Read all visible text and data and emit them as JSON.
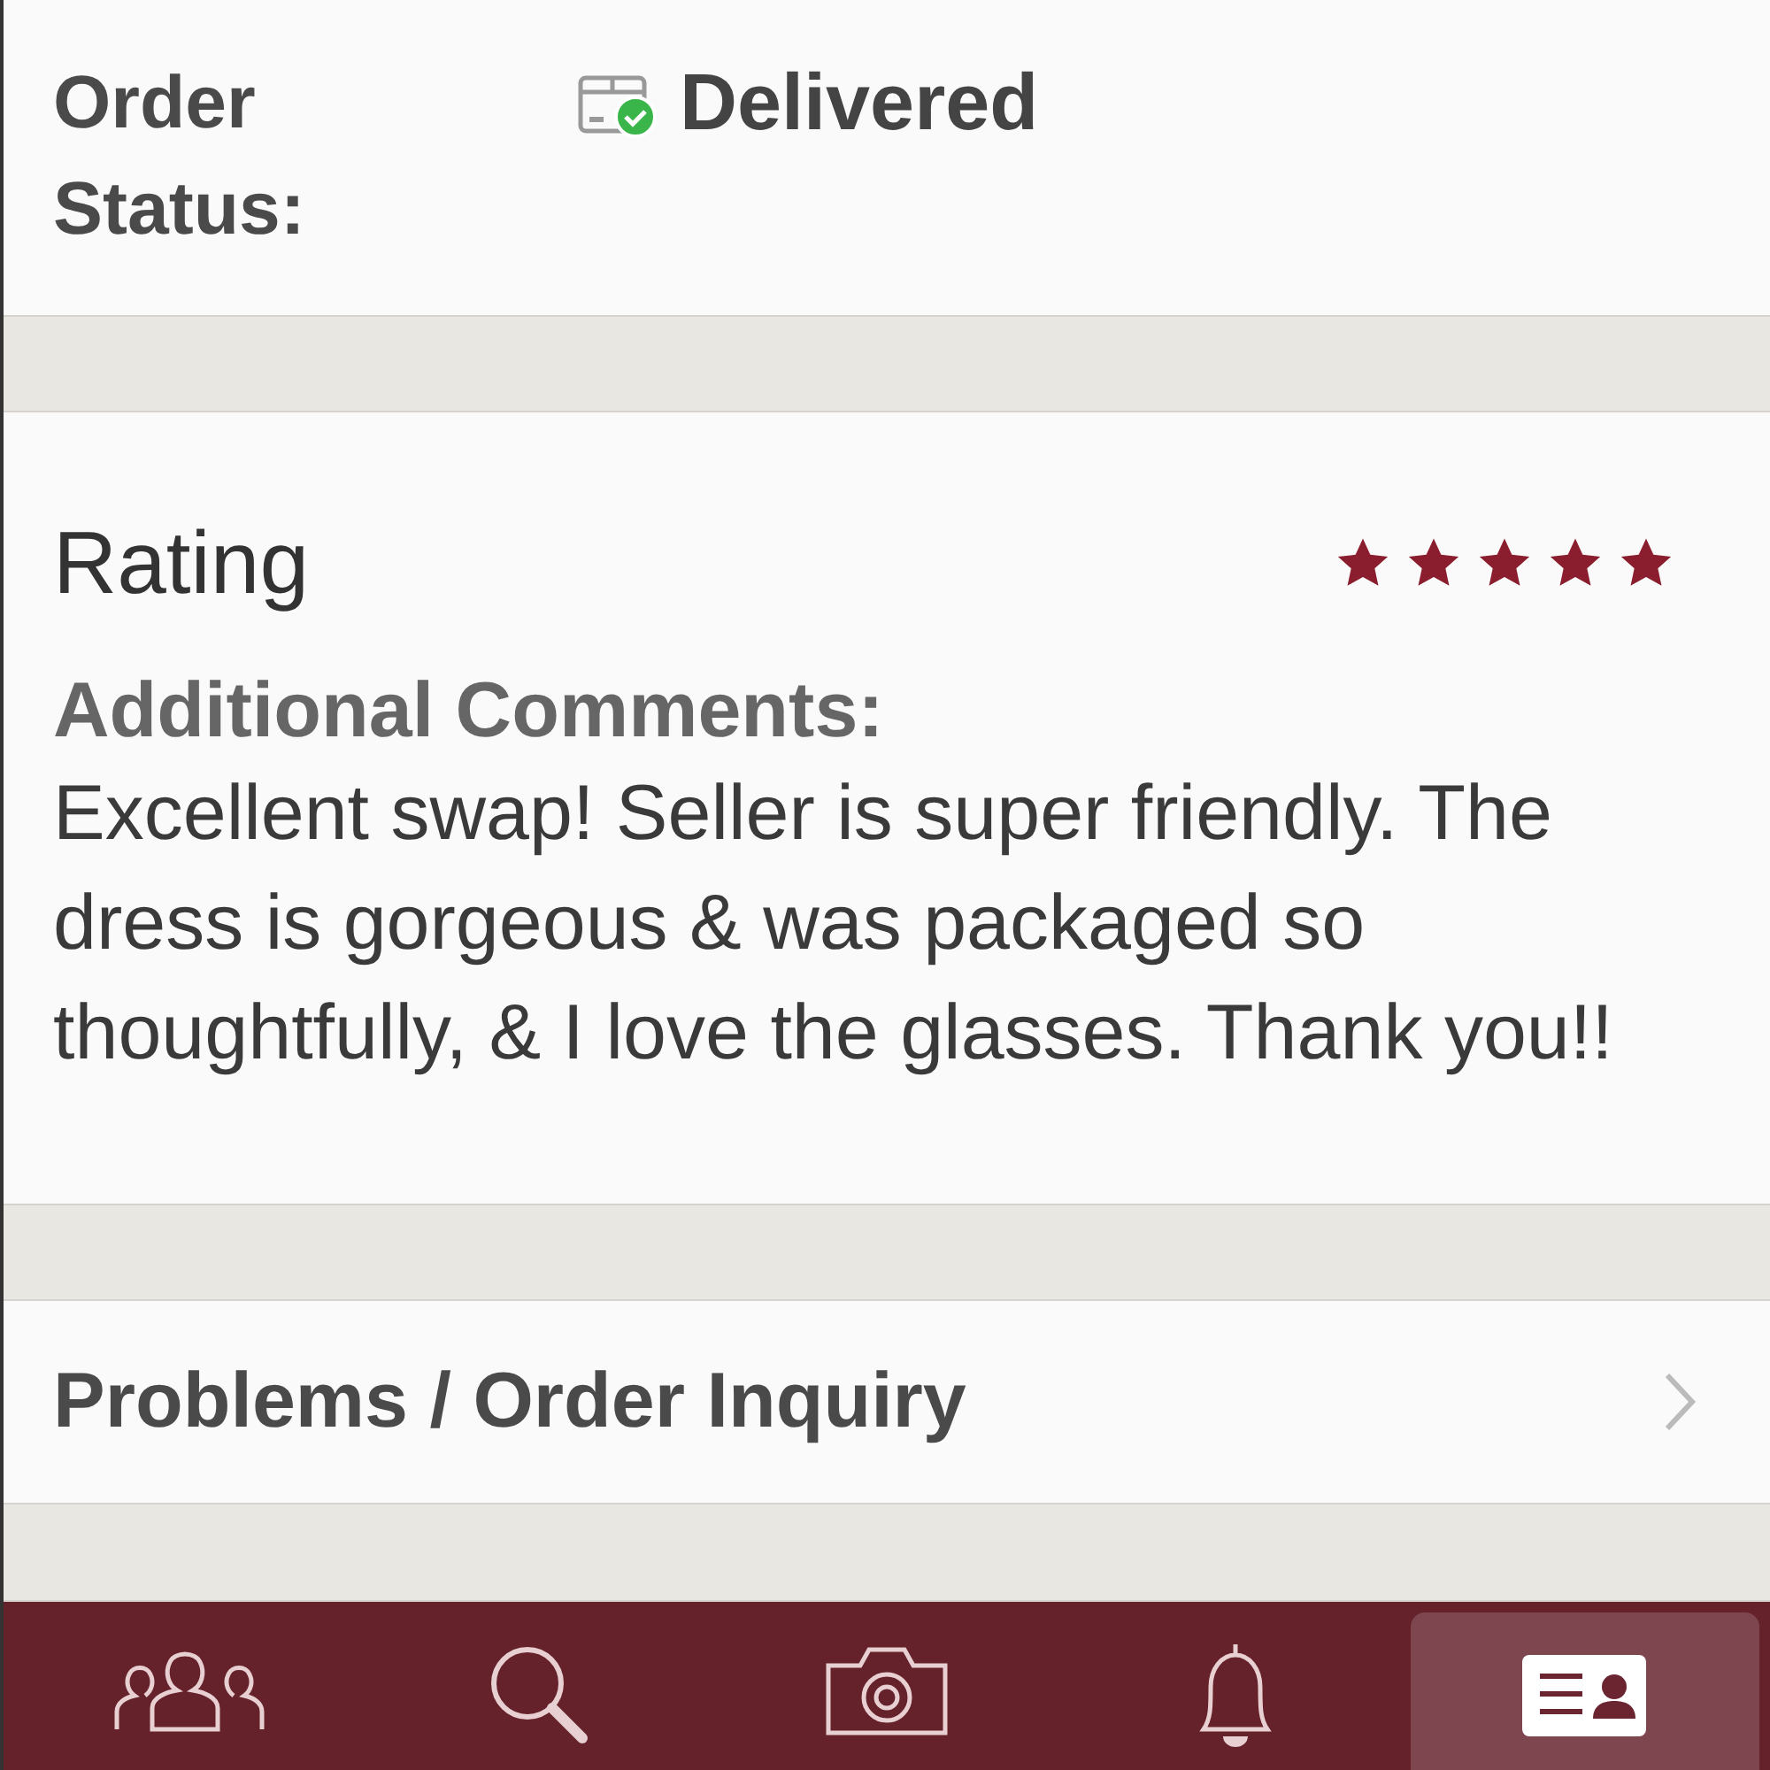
{
  "order_status": {
    "label": "Order Status:",
    "value": "Delivered"
  },
  "rating": {
    "title": "Rating",
    "stars": 5
  },
  "comments": {
    "label": "Additional Comments:",
    "text": "Excellent swap! Seller is super friendly. The dress is gorgeous & was packaged so thoughtfully, & I love the glasses. Thank you!!"
  },
  "inquiry": {
    "label": "Problems / Order Inquiry"
  },
  "tab_bar": [
    {
      "selected": false
    },
    {
      "selected": false
    },
    {
      "selected": false
    },
    {
      "selected": false
    },
    {
      "selected": true
    }
  ]
}
